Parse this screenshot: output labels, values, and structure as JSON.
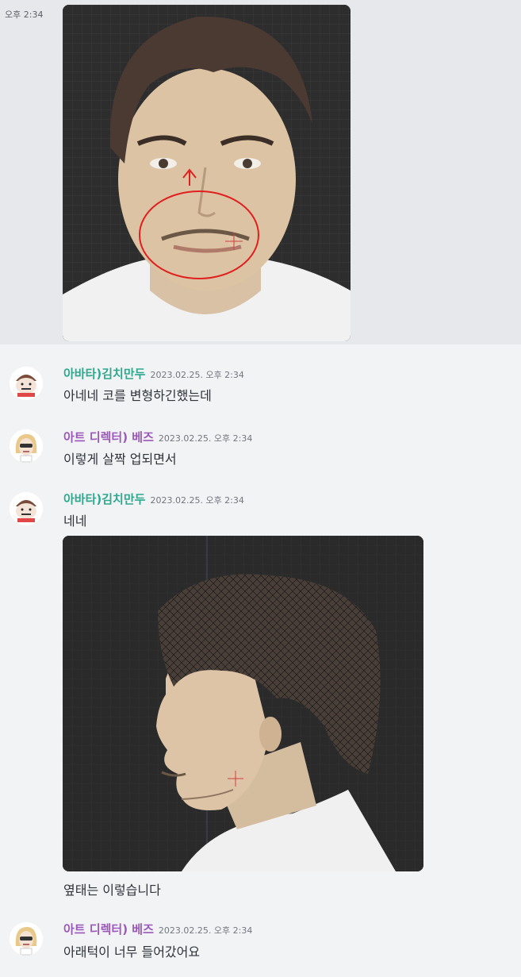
{
  "first_message": {
    "time": "오후 2:34"
  },
  "messages": [
    {
      "user": "아바타)김치만두",
      "timestamp": "2023.02.25. 오후 2:34",
      "text": "아네네 코를 변형하긴했는데"
    },
    {
      "user": "아트 디렉터) 베즈",
      "timestamp": "2023.02.25. 오후 2:34",
      "text": "이렇게 살짝 업되면서"
    },
    {
      "user": "아바타)김치만두",
      "timestamp": "2023.02.25. 오후 2:34",
      "text": "네네"
    },
    {
      "text": "옆태는 이렇습니다"
    },
    {
      "user": "아트 디렉터) 베즈",
      "timestamp": "2023.02.25. 오후 2:34",
      "text": "아래턱이 너무 들어갔어요"
    }
  ],
  "colors": {
    "user_green": "#2fa88e",
    "user_purple": "#9a58b8",
    "annotation_red": "#e02020"
  },
  "icons": {
    "avatar_kimchi": "cartoon-avatar",
    "avatar_bez": "cartoon-blonde-avatar"
  }
}
